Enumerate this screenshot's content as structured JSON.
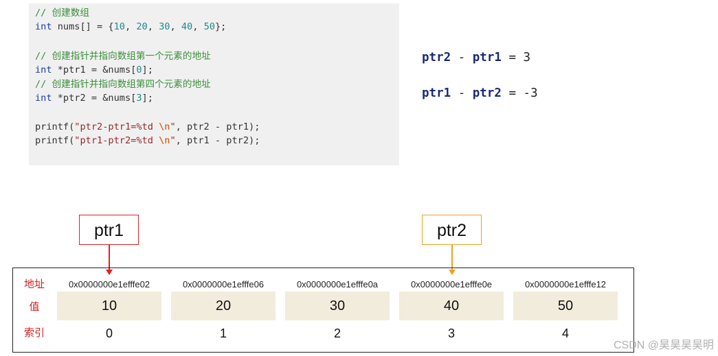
{
  "code": {
    "line1": {
      "comment": "// 创建数组"
    },
    "line2": {
      "kw": "int",
      "decl": " nums[] = {",
      "n1": "10",
      "s1": ", ",
      "n2": "20",
      "s2": ", ",
      "n3": "30",
      "s3": ", ",
      "n4": "40",
      "s4": ", ",
      "n5": "50",
      "end": "};"
    },
    "line4": {
      "comment": "// 创建指针并指向数组第一个元素的地址"
    },
    "line5": {
      "kw": "int",
      "decl": " *ptr1 = &nums[",
      "n": "0",
      "end": "];"
    },
    "line6": {
      "comment": "// 创建指针并指向数组第四个元素的地址"
    },
    "line7": {
      "kw": "int",
      "decl": " *ptr2 = &nums[",
      "n": "3",
      "end": "];"
    },
    "line9": {
      "fn": "printf(",
      "str": "\"ptr2-ptr1=%td ",
      "esc": "\\n",
      "str_end": "\"",
      "rest": ", ptr2 - ptr1);"
    },
    "line10": {
      "fn": "printf(",
      "str": "\"ptr1-ptr2=%td ",
      "esc": "\\n",
      "str_end": "\"",
      "rest": ", ptr1 - ptr2);"
    }
  },
  "results": [
    {
      "a": "ptr2",
      "op": " - ",
      "b": "ptr1",
      "eq": " = 3"
    },
    {
      "a": "ptr1",
      "op": " - ",
      "b": "ptr2",
      "eq": " = -3"
    }
  ],
  "pointers": {
    "ptr1": "ptr1",
    "ptr2": "ptr2"
  },
  "memory": {
    "labels": {
      "address": "地址",
      "value": "值",
      "index": "索引"
    },
    "cells": [
      {
        "address": "0x0000000e1efffe02",
        "value": "10",
        "index": "0"
      },
      {
        "address": "0x0000000e1efffe06",
        "value": "20",
        "index": "1"
      },
      {
        "address": "0x0000000e1efffe0a",
        "value": "30",
        "index": "2"
      },
      {
        "address": "0x0000000e1efffe0e",
        "value": "40",
        "index": "3"
      },
      {
        "address": "0x0000000e1efffe12",
        "value": "50",
        "index": "4"
      }
    ]
  },
  "watermark": "CSDN @昊昊昊昊明",
  "colors": {
    "ptr1_border": "#e02020",
    "ptr2_border": "#f0a020",
    "label_red": "#d02020",
    "cell_bg": "#f2ecdd"
  }
}
